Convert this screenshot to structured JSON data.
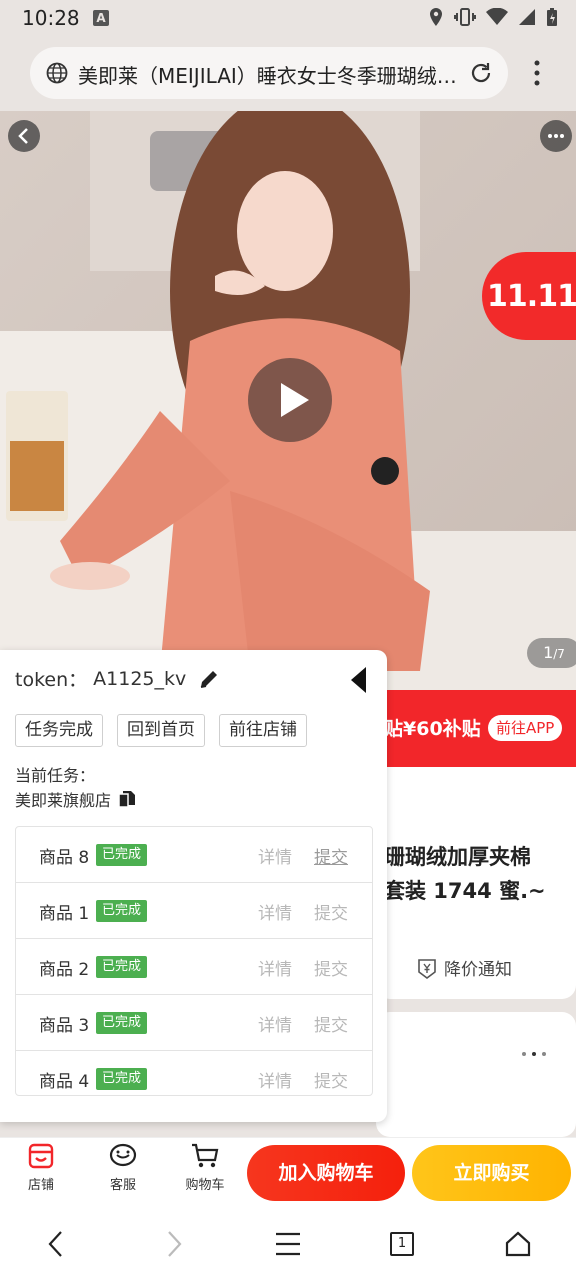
{
  "status_bar": {
    "time": "10:28",
    "notif_icon": "A"
  },
  "url_bar": {
    "title": "美即莱（MEIJILAI）睡衣女士冬季珊瑚绒加厚夹棉套装"
  },
  "gallery": {
    "badge": "11.11",
    "counter_current": "1",
    "counter_total": "/7"
  },
  "promo": {
    "text": "贴¥60补贴",
    "cta": "前往APP"
  },
  "product": {
    "title_line1": "珊瑚绒加厚夹棉",
    "title_line2": "套装 1744 蜜.~",
    "price_alert": "降价通知"
  },
  "panel": {
    "token_label": "token：",
    "token_value": "A1125_kv",
    "buttons": [
      "任务完成",
      "回到首页",
      "前往店铺"
    ],
    "current_task_label": "当前任务：",
    "current_task_value": "美即莱旗舰店",
    "tasks": [
      {
        "name": "商品 8",
        "status": "已完成",
        "detail": "详情",
        "submit": "提交"
      },
      {
        "name": "商品 1",
        "status": "已完成",
        "detail": "详情",
        "submit": "提交"
      },
      {
        "name": "商品 2",
        "status": "已完成",
        "detail": "详情",
        "submit": "提交"
      },
      {
        "name": "商品 3",
        "status": "已完成",
        "detail": "详情",
        "submit": "提交"
      },
      {
        "name": "商品 4",
        "status": "已完成",
        "detail": "详情",
        "submit": "提交"
      }
    ]
  },
  "action_bar": {
    "shop": "店铺",
    "service": "客服",
    "cart": "购物车",
    "add_to_cart": "加入购物车",
    "buy_now": "立即购买"
  },
  "nav_bar": {
    "tab_count": "1"
  },
  "colors": {
    "accent_red": "#f22a2a",
    "buy_yellow": "#ffb300",
    "done_green": "#4caf50"
  }
}
